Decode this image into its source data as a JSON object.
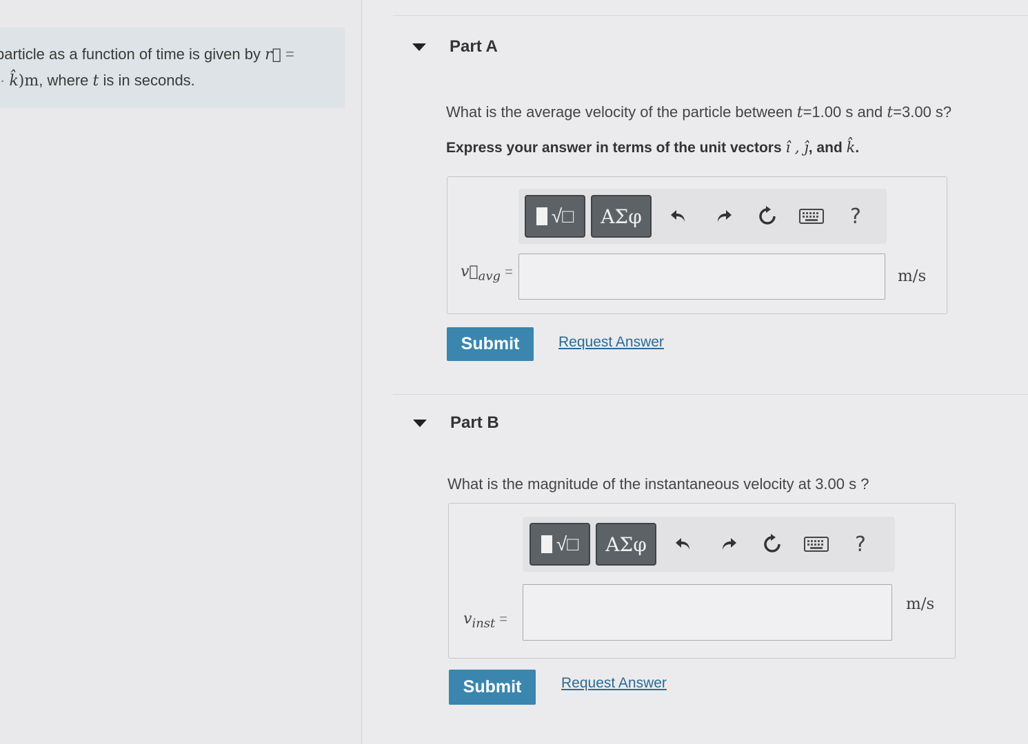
{
  "problem": {
    "line1_text": "particle as a function of time is given by",
    "line1_var": "r⃗",
    "line1_eq": "=",
    "line2_lead": "·",
    "line2_var": "k̂",
    "line2_unit": ")m",
    "line2_mid": ", where",
    "line2_t": "t",
    "line2_rest": "is in seconds."
  },
  "partA": {
    "title": "Part A",
    "question_pre": "What is the average velocity of the particle between",
    "t1_var": "t",
    "t1_val": "=1.00 s and",
    "t2_var": "t",
    "t2_val": "=3.00 s?",
    "instruction_pre": "Express your answer in terms of the unit vectors",
    "unit_vectors": "î , ĵ",
    "instruction_and": ", and",
    "unit_k": "k̂",
    "instruction_end": ".",
    "var_symbol": "v⃗",
    "var_sub": "avg",
    "var_eq": "=",
    "input_value": "",
    "unit": "m/s",
    "submit_label": "Submit",
    "request_label": "Request Answer"
  },
  "partB": {
    "title": "Part B",
    "question": "What is the magnitude of the instantaneous velocity at 3.00 s ?",
    "var_symbol": "v",
    "var_sub": "inst",
    "var_eq": "=",
    "input_value": "",
    "unit": "m/s",
    "submit_label": "Submit",
    "request_label": "Request Answer"
  },
  "toolbar": {
    "templates_label": "√□",
    "greek_label": "ΑΣφ",
    "help_label": "?",
    "icons": [
      "templates-icon",
      "greek-letters-icon",
      "undo-icon",
      "redo-icon",
      "reset-icon",
      "keyboard-icon",
      "help-icon"
    ]
  },
  "colors": {
    "submit": "#3a86ae",
    "link": "#2c6a95",
    "toolbar_button": "#5c6266",
    "problem_bg": "#dde3e6"
  }
}
